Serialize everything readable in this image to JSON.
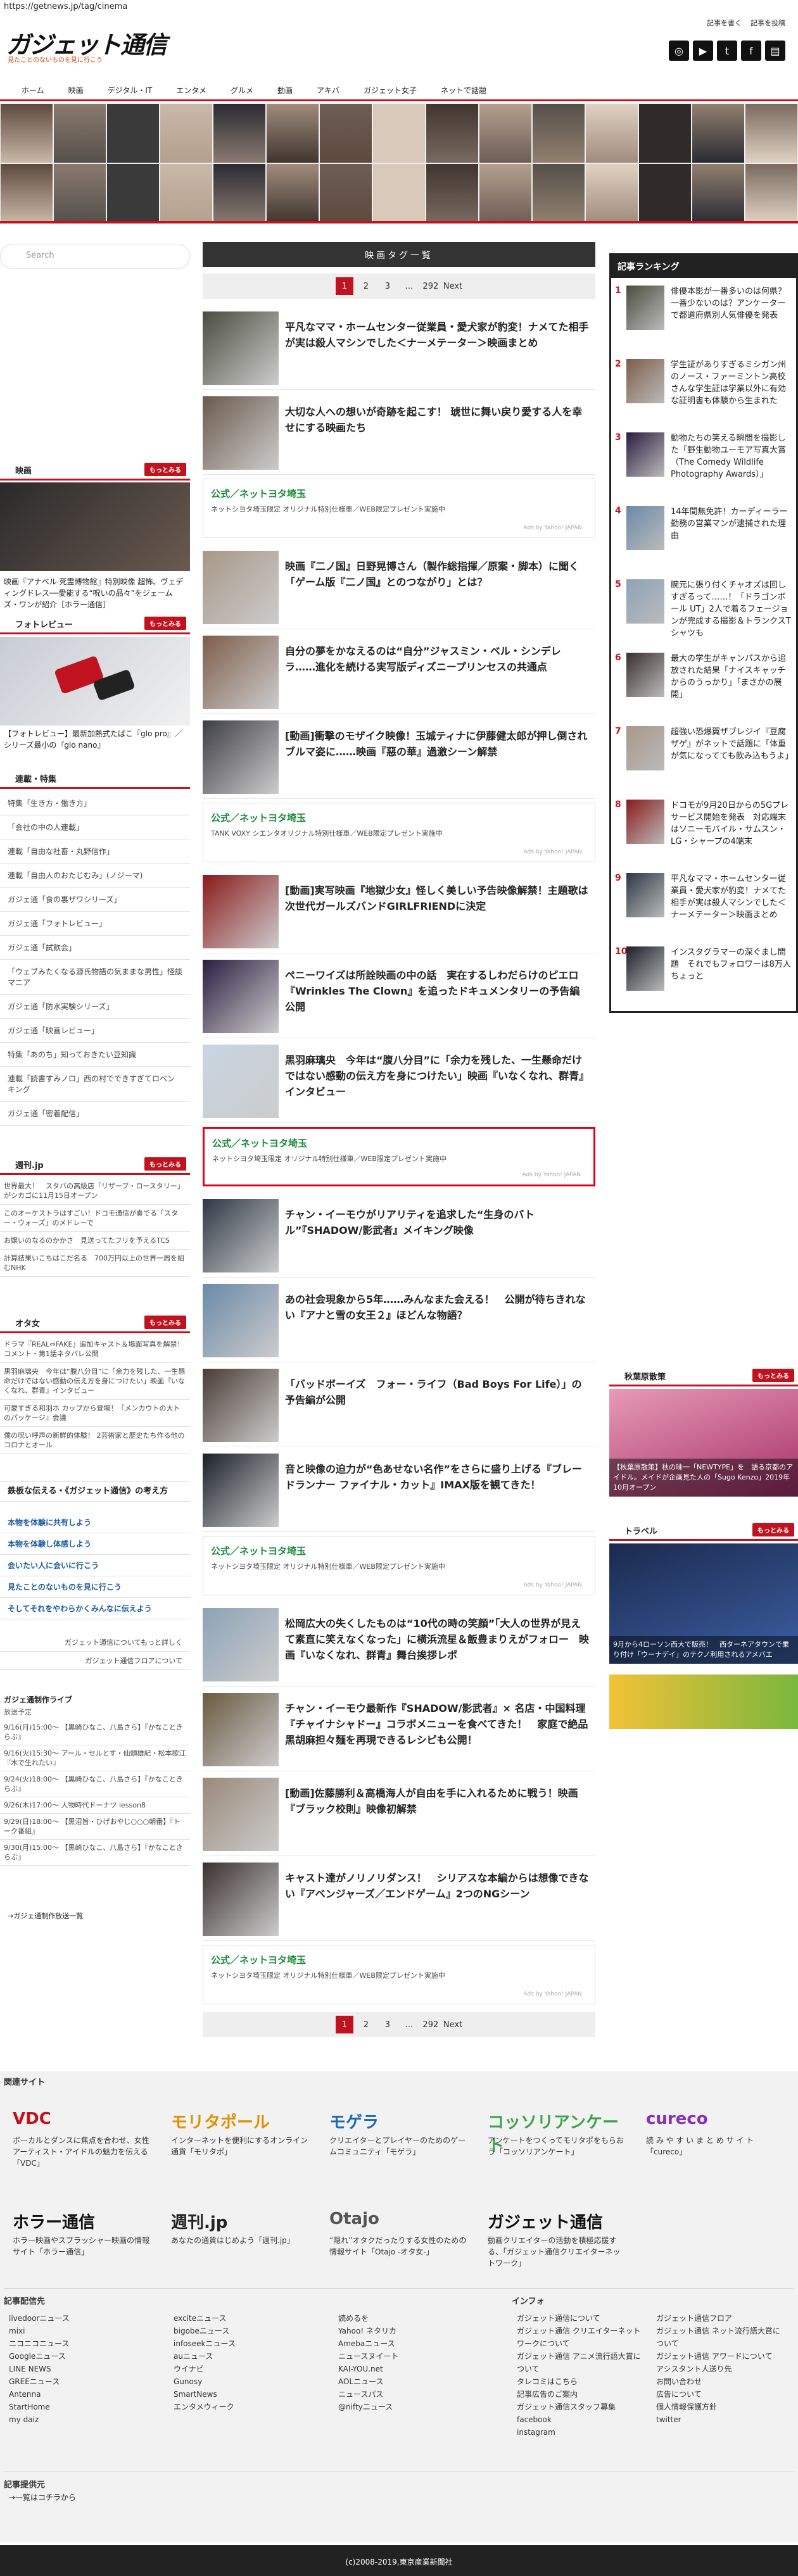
{
  "url": "https://getnews.jp/tag/cinema",
  "logo": "ガジェット通信",
  "logo_sub": "見たことのないものを見に行こう",
  "toplinks": [
    "記事を書く",
    "記事を投稿"
  ],
  "social": [
    "instagram-icon",
    "youtube-icon",
    "twitter-icon",
    "facebook-icon",
    "newspaper-icon"
  ],
  "nav": [
    "ホーム",
    "映画",
    "デジタル・IT",
    "エンタメ",
    "グルメ",
    "動画",
    "アキバ",
    "ガジェット女子",
    "ネットで話題"
  ],
  "search_placeholder": "Search",
  "center_title": "映画タグ一覧",
  "pager": {
    "pages": [
      "1",
      "2",
      "3",
      "…",
      "292",
      "Next"
    ]
  },
  "articles": [
    {
      "title": "平凡なママ・ホームセンター従業員・愛犬家が豹変！ナメてた相手が実は殺人マシンでした＜ナーメテーター＞映画まとめ"
    },
    {
      "title": "大切な人への想いが奇跡を起こす！ 琥世に舞い戻り愛する人を幸せにする映画たち"
    },
    {
      "title": "映画『二ノ国』日野晃博さん（製作総指揮／原案・脚本）に聞く「ゲーム版『二ノ国』とのつながり」とは？"
    },
    {
      "title": "自分の夢をかなえるのは“自分”ジャスミン・ベル・シンデレラ……進化を続ける実写版ディズニープリンセスの共通点"
    },
    {
      "title": "[動画]衝撃のモザイク映像！玉城ティナに伊藤健太郎が押し倒されブルマ姿に……映画『惡の華』過激シーン解禁"
    },
    {
      "title": "[動画]実写映画『地獄少女』怪しく美しい予告映像解禁！主題歌は次世代ガールズバンドGIRLFRIENDに決定"
    },
    {
      "title": "ペニーワイズは所詮映画の中の話　実在するしわだらけのピエロ『Wrinkles The Clown』を追ったドキュメンタリーの予告編公開"
    },
    {
      "title": "黒羽麻璃央　今年は“腹八分目”に「余力を残した、一生懸命だけではない感動の伝え方を身につけたい」映画『いなくなれ、群青』インタビュー"
    },
    {
      "title": "チャン・イーモウがリアリティを追求した“生身のバトル”『SHADOW/影武者』メイキング映像"
    },
    {
      "title": "あの社会現象から5年……みんなまた会える！　公開が待ちきれない『アナと雪の女王２』ほどんな物語？"
    },
    {
      "title": "「バッドボーイズ　フォー・ライフ（Bad Boys For Life）」の予告編が公開"
    },
    {
      "title": "音と映像の迫力が“色あせない名作”をさらに盛り上げる『ブレードランナー ファイナル・カット』IMAX版を観てきた！"
    },
    {
      "title": "松岡広大の失くしたものは“10代の時の笑顔”「大人の世界が見えて素直に笑えなくなった」に横浜流星＆飯豊まりえがフォロー　映画『いなくなれ、群青』舞台挨拶レポ"
    },
    {
      "title": "チャン・イーモウ最新作『SHADOW/影武者』× 名店・中国料理『チャイナシャドー』コラボメニューを食べてきた！　家庭で絶品 黒胡麻担々麺を再現できるレシピも公開！"
    },
    {
      "title": "[動画]佐藤勝利＆高橋海人が自由を手に入れるために戦う！映画『ブラック校則』映像初解禁"
    },
    {
      "title": "キャスト達がノリノリダンス！　シリアスな本編からは想像できない『アベンジャーズ／エンドゲーム』2つのNGシーン"
    }
  ],
  "ads": [
    {
      "title": "公式／ネットヨタ埼玉",
      "text": "ネットシヨタ埼玉限定 オリジナル特別仕様車／WEB限定プレゼント実施中",
      "by": "Ads by Yahoo! JAPAN"
    },
    {
      "title": "公式／ネットヨタ埼玉",
      "text": "TANK VOXY シエンタオリジナル特別仕様車／WEB限定プレゼント実施中",
      "by": "Ads by Yahoo! JAPAN"
    },
    {
      "title": "公式／ネットヨタ埼玉",
      "text": "ネットシヨタ埼玉限定 オリジナル特別仕様車／WEB限定プレゼント実施中",
      "by": "Ads by Yahoo! JAPAN"
    },
    {
      "title": "公式／ネットヨタ埼玉",
      "text": "ネットシヨタ埼玉限定 オリジナル特別仕様車／WEB限定プレゼント実施中",
      "by": "Ads by Yahoo! JAPAN"
    },
    {
      "title": "公式／ネットヨタ埼玉",
      "text": "ネットシヨタ埼玉限定 オリジナル特別仕様車／WEB限定プレゼント実施中",
      "by": "Ads by Yahoo! JAPAN"
    }
  ],
  "left": {
    "movie_head": "映画",
    "more": "もっとみる",
    "movie_text": "映画『アナベル 死霊博物館』特別映像 超怖、ヴェディングドレス──愛能する“呪いの品々”をジェームズ・ワンが紹介［ホラー通信］",
    "photo_head": "フォトレビュー",
    "photo_text": "【フォトレビュー】最新加熱式たばこ『glo pro』／シリーズ最小の『glo nano』",
    "feature_head": "連載・特集",
    "features": [
      "特集「生き方・働き方」",
      "「会社の中の人連載」",
      "連載「自由な社畜・丸野信作」",
      "連載「自由人のおたじむみ」(ノジーマ)",
      "ガジェ通「食の裏ザワシリーズ」",
      "ガジェ通「フォトレビュー」",
      "ガジェ通「試飲会」",
      "「ウェブみたくなる源氏物語の気ままな男性」怪談マニア",
      "ガジェ通「防水実験シリーズ」",
      "ガジェ通「映画レビュー」",
      "特集「あのち」知っておきたい豆知識",
      "連載「読書すみノロ」西の村でできすぎてロベンキング",
      "ガジェ通「密着配信」"
    ],
    "denchu_head": "週刊.jp",
    "denchu": [
      "世界最大！　スタバの高級店「リザーブ・ロースタリー」がシカゴに11月15日オープン",
      "このオーケストラはすごい！ドコモ通信が奏でる「スター・ウォーズ」のメドレーで",
      "お嬢いのなるのかかさ　見送ってたフリを予えるTCS",
      "計算結果いこちはこだ名る　700万円以上の世界一周を組むNHK"
    ],
    "otaku_head": "オタ女",
    "otaku": [
      "ドラマ『REAL⇔FAKE』追加キャスト＆場面写真を解禁！ コメント・第1話ネタバレ公開",
      "黒羽麻璃央　今年は“腹八分目”に「余力を残した、一生懸命だけではない感動の伝え方を身につけたい」映画『いなくなれ、群青』インタビュー",
      "可愛すぎる和羽ホ カップから登場！『メンカウトの大トのパッケージ』会議",
      "僕の呪い呼声の新鮮的体験！ 2芸術家と歴史たち作る他のコロナとオール"
    ],
    "links_head": "鉄板な伝える・《ガジェット通信》の考え方",
    "links": [
      "本物を体験に共有しよう",
      "本物を体験し体感しよう",
      "会いたい人に会いに行こう",
      "見たことのないものを見に行こう",
      "そしてそれをやわらかくみんなに伝えよう"
    ],
    "links2": [
      "ガジェット通信についてもっと詳しく",
      "ガジェット通信フロアについて"
    ],
    "tv_head": "ガジェ通制作ライブ",
    "tv_sub": "放送予定",
    "tv_items": [
      "9/16(月)15:00〜 【黒崎ひなこ、八島さら】『かなこときらぶ』",
      "9/16(火)15:30〜 アール・セルとす・仙頭雄紀・松本歌江『木で生れたい』",
      "9/24(火)18:00〜 【黒崎ひなこ、八島さら】『かなこときらぶ』",
      "9/26(木)17:00〜 人物時代ドーナツ lesson8",
      "9/29(日)18:00〜 【黒沼旨・ひげおやじ○○○朝番】『トーク番組』",
      "9/30(月)15:00〜 【黒崎ひなこ、八島さら】『かなこときらぶ』"
    ],
    "tv_more": "→ガジェ通制作放送一覧"
  },
  "ranking": {
    "head": "記事ランキング",
    "items": [
      "俳優本影が一番多いのは何県？　一番少ないのは？アンケーターで都道府県別人気俳優を発表",
      "学生証がありすぎるミシガン州のノース・ファーミントン高校　さんな学生証は学業以外に有効な証明書も体験から生まれた",
      "動物たちの笑える瞬間を撮影した「野生動物ユーモア写真大賞（The Comedy Wildlife Photography Awards）」",
      "14年間無免許！カーディーラー勤務の営業マンが逮捕された理由",
      "腕元に張り付くチャオズは回しすぎるって……！「ドラゴンボール UT」2人で着るフェージョンが完成する撮影＆トランクスTシャツも",
      "最大の学生がキャンパスから追放された結果「ナイスキャッチからのうっかり」「まさかの展開」",
      "超強い恐爆翼ザブレジイ『豆腐ザゲ』がネットで話題に「体重が気になってても飲み込もうよ」",
      "ドコモが9月20日からの5Gプレサービス開始を発表　対応端末はソニーモバイル・サムスン・LG・シャープの4端末",
      "平凡なママ・ホームセンター従業員・愛犬家が豹変！ナメてた相手が実は殺人マシンでした＜ナーメテーター＞映画まとめ",
      "インスタグラマーの深ぐまし問題　それでもフォロワーは8万人ちょっと"
    ]
  },
  "right_ads": [
    {
      "head": "秋葉原散策",
      "more": "もっとみる",
      "text": "【秋葉原散策】秋の味一「NEWTYPE」を　語る京都のアイドル。メイドが企画見た人の「Sugo Kenzo」2019年10月オープン"
    },
    {
      "head": "トラベル",
      "more": "もっとみる",
      "text": "9月から4ローソン西大で販売！　西ターネアタウンで乗り付け「ウーナデイ」のテクノ利用されるアメバエ"
    }
  ],
  "footer": {
    "related_head": "関連サイト",
    "sites": [
      {
        "logo": "VDC",
        "desc": "ボーカルとダンスに焦点を合わせ、女性アーティスト・アイドルの魅力を伝える「VDC」"
      },
      {
        "logo": "モリタポール",
        "desc": "インターネットを便利にするオンライン通貨「モリタポ」"
      },
      {
        "logo": "モゲラ",
        "desc": "クリエイターとプレイヤーのためのゲームコミュニティ「モゲラ」"
      },
      {
        "logo": "コッソリアンケート",
        "desc": "アンケートをつくってモリタポをもらおう「コッソリアンケート」"
      },
      {
        "logo": "cureco",
        "desc": "読 み や す い ま と め サ イ ト「cureco」"
      },
      {
        "logo": "ホラー通信",
        "desc": "ホラー映画やスプラッシャー映画の情報サイト「ホラー通信」"
      },
      {
        "logo": "週刊.jp",
        "desc": "あなたの通貨はじめよう「週刊.jp」"
      },
      {
        "logo": "Otajo",
        "desc": "“隠れ”オタクだったりする女性のための情報サイト「Otajo -オタ女-」"
      },
      {
        "logo": "ガジェット通信",
        "desc": "動画クリエイターの活動を積極応援する、「ガジェット通信クリエイターネットワーク」"
      }
    ],
    "dist_head": "記事配信先",
    "dist_cols": [
      [
        "livedoorニュース",
        "mixi",
        "ニコニコニュース",
        "Googleニュース",
        "LINE NEWS",
        "GREEニュース",
        "Antenna",
        "StartHome",
        "my daiz"
      ],
      [
        "exciteニュース",
        "bigobeニュース",
        "infoseekニュース",
        "auニュース",
        "ウイナビ",
        "Gunosy",
        "SmartNews",
        "エンタメウィーク"
      ],
      [
        "読めるを",
        "Yahoo! ネタリカ",
        "Amebaニュース",
        "ニュースヌイート",
        "KAI-YOU.net",
        "AOLニュース",
        "ニュースパス",
        "@niftyニュース"
      ]
    ],
    "info_head": "インフォ",
    "info_cols": [
      [
        "ガジェット通信について",
        "ガジェット通信 クリエイターネットワークについて",
        "ガジェット通信 アニメ流行語大賞について",
        "タレコミはこちら",
        "記事広告のご案内",
        "ガジェット通信スタッフ募集",
        "facebook",
        "instagram"
      ],
      [
        "ガジェット通信フロア",
        "ガジェット通信 ネット流行語大賞について",
        "ガジェット通信 アワードについて",
        "アシスタント人送り先",
        "お問い合わせ",
        "広告について",
        "個人情報保護方針",
        "twitter"
      ]
    ],
    "provider_head": "記事提供元",
    "provider": "→一覧はコチラから",
    "copyright": "(c)2008-2019,東京産業新聞社"
  }
}
